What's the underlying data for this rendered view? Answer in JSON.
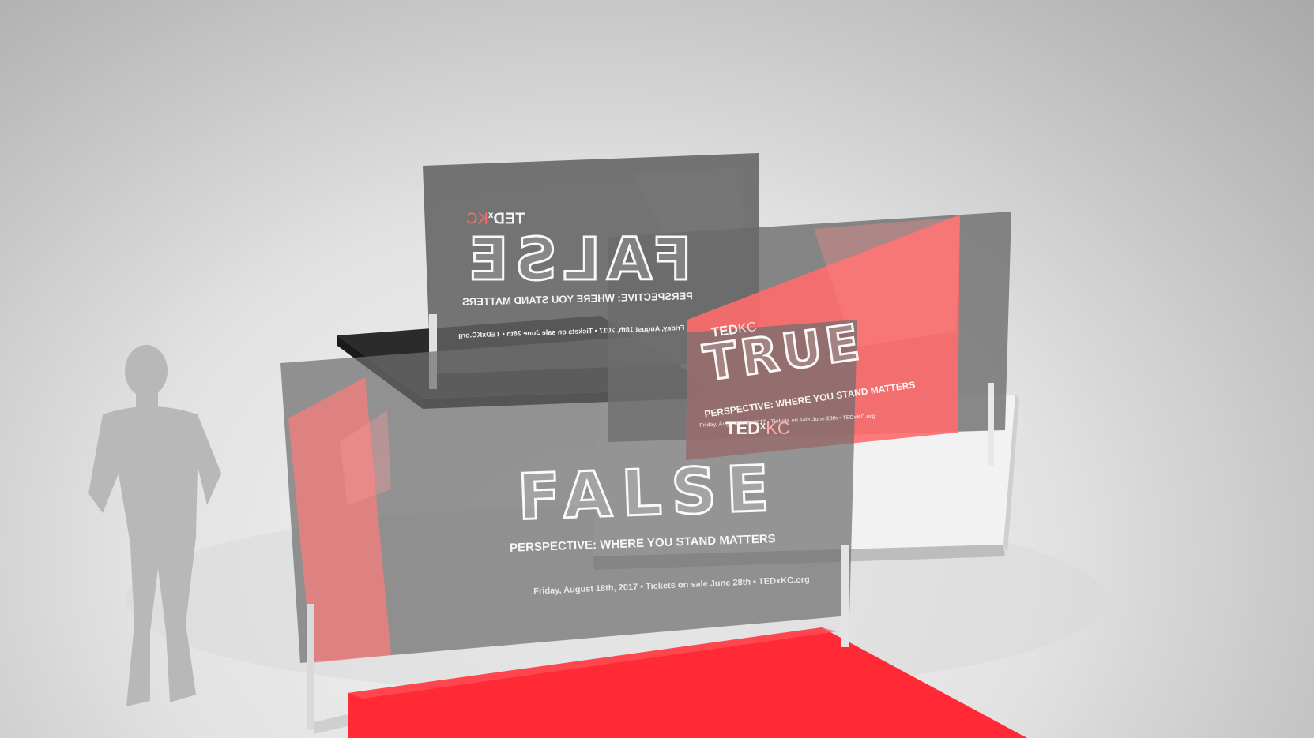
{
  "colors": {
    "red_floor": "#e81e2a",
    "red_panel": "#ff6b6b",
    "dark_platform": "#2b2b2b",
    "glass": "#6e6e6e",
    "silhouette": "#b3b3b3"
  },
  "back_panel": {
    "brand_ted": "TED",
    "brand_x": "x",
    "brand_kc": "KC",
    "word": "FALSE",
    "tagline": "PERSPECTIVE: WHERE YOU STAND MATTERS",
    "details": "Friday, August 18th, 2017 • Tickets on sale June 28th • TEDxKC.org"
  },
  "right_panel": {
    "brand_ted": "TED",
    "brand_kc": "KC",
    "word": "TRUE",
    "tagline": "PERSPECTIVE: WHERE YOU STAND MATTERS",
    "details": "Friday, August 18th, 2017 • Tickets on sale June 28th • TEDxKC.org",
    "brand_bottom_ted": "TED",
    "brand_bottom_x": "x",
    "brand_bottom_kc": "KC"
  },
  "front_panel": {
    "word": "FALSE",
    "tagline": "PERSPECTIVE: WHERE YOU STAND MATTERS",
    "details": "Friday, August 18th, 2017 • Tickets on sale June 28th • TEDxKC.org"
  }
}
